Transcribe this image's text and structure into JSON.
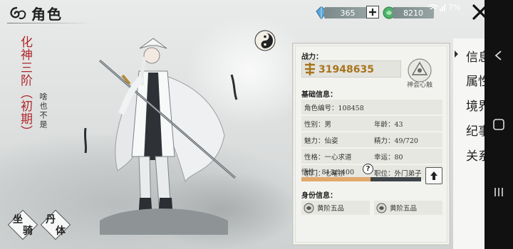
{
  "header": {
    "title": "角色",
    "currency_jade": "365",
    "currency_spirit": "8210",
    "status_text": "7%"
  },
  "character": {
    "rank": "化神三阶（初期）",
    "motto": "啥也不是"
  },
  "bottom_buttons": {
    "mount": [
      "坐",
      "骑"
    ],
    "pill": [
      "丹",
      "体"
    ]
  },
  "panel": {
    "power_label": "战力：",
    "power_value": "31948635",
    "seal_label": "神会心触",
    "basic_label": "基础信息：",
    "char_id": "角色编号：108458",
    "gender": "性别：男",
    "age": "年龄：43",
    "charm": "魅力：仙姿",
    "energy": "精力：49/720",
    "personality": "性格：一心求道",
    "luck": "幸运：80",
    "sect": "宗门：七曜宗",
    "position": "职位：外门弟子",
    "comprehension": "悟性：813/1400",
    "comprehension_progress": 0.58,
    "identity_label": "身份信息：",
    "identity_1": "黄阶五品",
    "identity_2": "黄阶五品"
  },
  "menu": [
    "信息",
    "属性",
    "境界",
    "纪事",
    "关系"
  ],
  "colors": {
    "rank_red": "#b0262a",
    "power_gold": "#a7741c",
    "bar_fill": "#e2a96a"
  }
}
